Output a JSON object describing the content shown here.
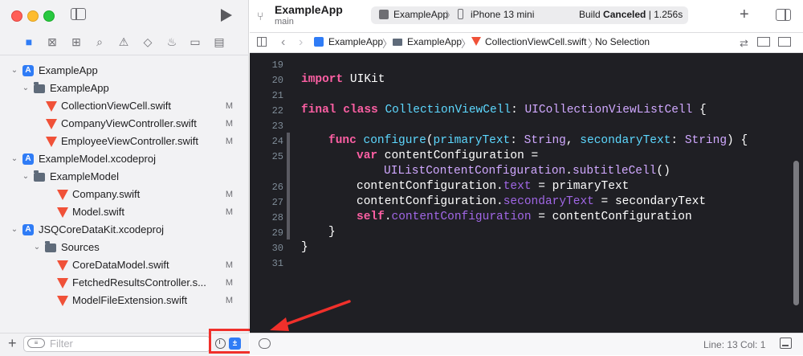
{
  "window": {
    "app_title": "ExampleApp",
    "branch": "main"
  },
  "toolbar": {
    "scheme_app": "ExampleApp",
    "scheme_sep": "〉",
    "scheme_device": "iPhone 13 mini",
    "build_label": "Build",
    "build_status": "Canceled",
    "build_separator": "|",
    "build_time": "1.256s",
    "add_label": "+"
  },
  "jump_bar": {
    "crumbs": [
      "ExampleApp",
      "ExampleApp",
      "CollectionViewCell.swift",
      "No Selection"
    ],
    "sep": "〉"
  },
  "navigator": {
    "items": [
      {
        "label": "ExampleApp",
        "badge": ""
      },
      {
        "label": "ExampleApp",
        "badge": ""
      },
      {
        "label": "CollectionViewCell.swift",
        "badge": "M"
      },
      {
        "label": "CompanyViewController.swift",
        "badge": "M"
      },
      {
        "label": "EmployeeViewController.swift",
        "badge": "M"
      },
      {
        "label": "ExampleModel.xcodeproj",
        "badge": ""
      },
      {
        "label": "ExampleModel",
        "badge": ""
      },
      {
        "label": "Company.swift",
        "badge": "M"
      },
      {
        "label": "Model.swift",
        "badge": "M"
      },
      {
        "label": "JSQCoreDataKit.xcodeproj",
        "badge": ""
      },
      {
        "label": "Sources",
        "badge": ""
      },
      {
        "label": "CoreDataModel.swift",
        "badge": "M"
      },
      {
        "label": "FetchedResultsController.s...",
        "badge": "M"
      },
      {
        "label": "ModelFileExtension.swift",
        "badge": "M"
      }
    ],
    "filter_placeholder": "Filter",
    "add_label": "+"
  },
  "editor": {
    "line_numbers": [
      "19",
      "20",
      "21",
      "22",
      "23",
      "24",
      "25",
      "",
      "26",
      "27",
      "28",
      "29",
      "30",
      "31"
    ],
    "code": {
      "l20_kw": "import",
      "l20_rest": " UIKit",
      "l22_kw1": "final",
      "l22_kw2": "class",
      "l22_name": "CollectionViewCell",
      "l22_colon": ": ",
      "l22_super": "UICollectionViewListCell",
      "l22_brace": " {",
      "l24_kw": "func",
      "l24_fn": "configure",
      "l24_p1": "(",
      "l24_arg1": "primaryText",
      "l24_c1": ": ",
      "l24_t1": "String",
      "l24_comma": ", ",
      "l24_arg2": "secondaryText",
      "l24_c2": ": ",
      "l24_t2": "String",
      "l24_end": ") {",
      "l25_kw": "var",
      "l25_rest": " contentConfiguration =",
      "l25b_type": "UIListContentConfiguration",
      "l25b_dot": ".",
      "l25b_call": "subtitleCell",
      "l25b_end": "()",
      "l26_a": "contentConfiguration.",
      "l26_prop": "text",
      "l26_b": " = primaryText",
      "l27_a": "contentConfiguration.",
      "l27_prop": "secondaryText",
      "l27_b": " = secondaryText",
      "l28_kw": "self",
      "l28_dot": ".",
      "l28_prop": "contentConfiguration",
      "l28_b": " = contentConfiguration",
      "l29": "}",
      "l30": "}"
    }
  },
  "status_bar": {
    "line_col": "Line: 13  Col: 1"
  },
  "colors": {
    "editor_bg": "#1f1f24",
    "keyword": "#fc5fa3",
    "type": "#d0a8ff",
    "declaration": "#5dd8ff",
    "annotation_red": "#f0302b",
    "accent": "#2f7cf6"
  }
}
